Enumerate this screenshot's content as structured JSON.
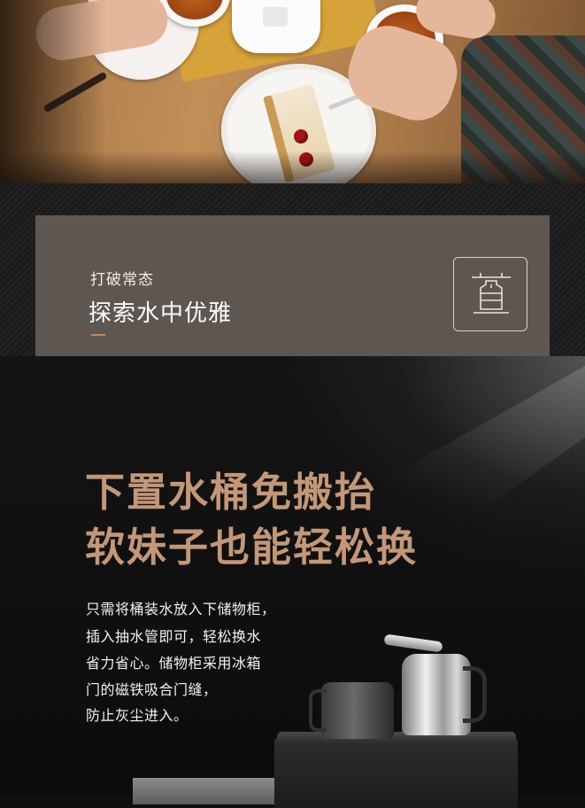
{
  "banner": {
    "subtitle": "打破常态",
    "title": "探索水中优雅",
    "icon": "water-dispenser-icon"
  },
  "product": {
    "headline_line1": "下置水桶免搬抬",
    "headline_line2": "软妹子也能轻松换",
    "description_lines": [
      "只需将桶装水放入下储物柜，",
      "插入抽水管即可，轻松换水",
      "省力省心。储物柜采用冰箱",
      "门的磁铁吸合门缝，",
      "防止灰尘进入。"
    ]
  },
  "colors": {
    "card": "#5e5651",
    "headline": "#c39777",
    "accent_dash": "#c48a5f",
    "background": "#0f0f0f"
  }
}
